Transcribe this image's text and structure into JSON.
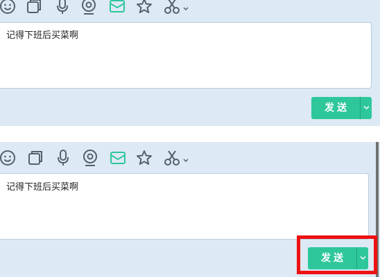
{
  "panels": [
    {
      "toolbar": {
        "icons": [
          "emoji-icon",
          "screenshot-icon",
          "microphone-icon",
          "camera-icon",
          "mail-icon",
          "star-icon",
          "scissors-icon",
          "chevron-down-icon"
        ]
      },
      "input": {
        "value": "记得下班后买菜啊"
      },
      "send": {
        "label": "发送"
      }
    },
    {
      "toolbar": {
        "icons": [
          "emoji-icon",
          "screenshot-icon",
          "microphone-icon",
          "camera-icon",
          "mail-icon",
          "star-icon",
          "scissors-icon",
          "chevron-down-icon"
        ]
      },
      "input": {
        "value": "记得下班后买菜啊"
      },
      "send": {
        "label": "发送"
      }
    }
  ],
  "colors": {
    "panel_bg": "#dde9f5",
    "accent": "#2ec79c",
    "icon_gray": "#55606b",
    "highlight": "#ee1111"
  }
}
